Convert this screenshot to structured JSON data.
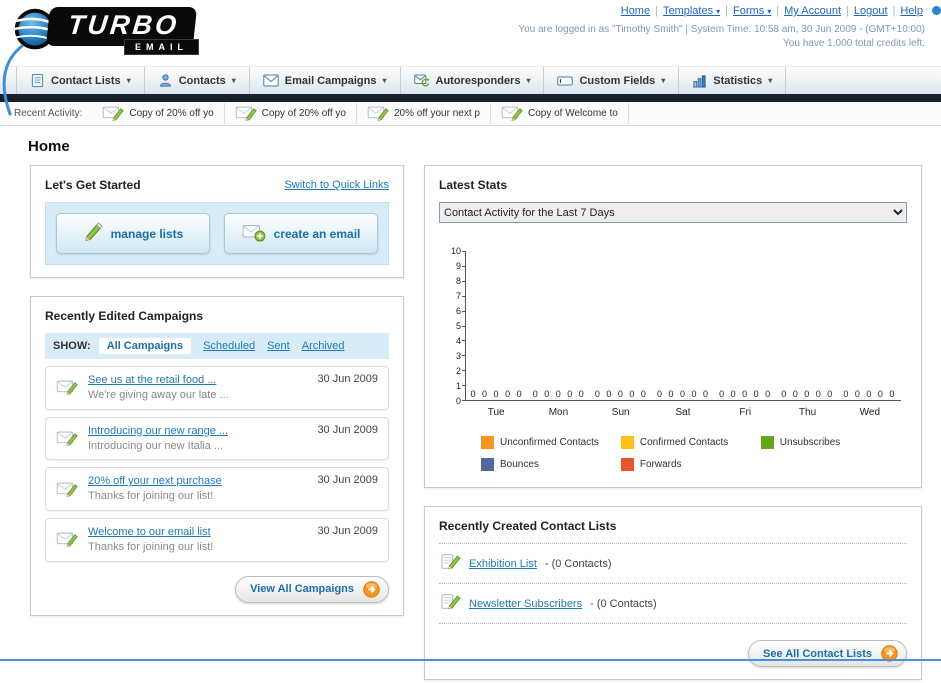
{
  "header": {
    "logo": {
      "word": "TURBO",
      "sub": "EMAIL"
    },
    "links": [
      {
        "label": "Home",
        "dropdown": false
      },
      {
        "label": "Templates",
        "dropdown": true
      },
      {
        "label": "Forms",
        "dropdown": true
      },
      {
        "label": "My Account",
        "dropdown": false
      },
      {
        "label": "Logout",
        "dropdown": false
      },
      {
        "label": "Help",
        "dropdown": false
      }
    ],
    "login_info": "You are logged in as \"Timothy Smith\" | System Time: 10:58 am, 30 Jun 2009 - (GMT+10:00)",
    "credits": "You have 1,000 total credits left."
  },
  "nav_tabs": [
    {
      "label": "Contact Lists",
      "icon": "contact-lists-icon"
    },
    {
      "label": "Contacts",
      "icon": "contacts-icon"
    },
    {
      "label": "Email Campaigns",
      "icon": "email-campaigns-icon"
    },
    {
      "label": "Autoresponders",
      "icon": "autoresponders-icon"
    },
    {
      "label": "Custom Fields",
      "icon": "custom-fields-icon"
    },
    {
      "label": "Statistics",
      "icon": "statistics-icon"
    }
  ],
  "recent_activity": {
    "label": "Recent Activity:",
    "items": [
      {
        "text": "Copy of 20% off yo",
        "icon": "envelope-pencil-icon"
      },
      {
        "text": "Copy of 20% off yo",
        "icon": "envelope-pencil-icon"
      },
      {
        "text": "20% off your next p",
        "icon": "envelope-pencil-icon"
      },
      {
        "text": "Copy of Welcome to",
        "icon": "envelope-pencil-icon"
      }
    ]
  },
  "page_title": "Home",
  "get_started": {
    "title": "Let's Get Started",
    "switch_link": "Switch to Quick Links",
    "buttons": [
      {
        "label": "manage lists",
        "icon": "pencil-icon"
      },
      {
        "label": "create an email",
        "icon": "envelope-plus-icon"
      }
    ]
  },
  "campaigns": {
    "title": "Recently Edited Campaigns",
    "show_label": "SHOW:",
    "filters": [
      {
        "label": "All Campaigns",
        "active": true
      },
      {
        "label": "Scheduled",
        "active": false
      },
      {
        "label": "Sent",
        "active": false
      },
      {
        "label": "Archived",
        "active": false
      }
    ],
    "items": [
      {
        "title": "See us at the retail food ...",
        "subtitle": "We're giving away our late ...",
        "date": "30 Jun 2009"
      },
      {
        "title": "Introducing our new range ...",
        "subtitle": "Introducing our new Italia ...",
        "date": "30 Jun 2009"
      },
      {
        "title": "20% off your next purchase",
        "subtitle": "Thanks for joining our list!",
        "date": "30 Jun 2009"
      },
      {
        "title": "Welcome to our email list",
        "subtitle": "Thanks for joining our list!",
        "date": "30 Jun 2009"
      }
    ],
    "view_all_label": "View All Campaigns"
  },
  "stats": {
    "title": "Latest Stats",
    "dropdown_value": "Contact Activity for the Last 7 Days"
  },
  "chart_data": {
    "type": "bar",
    "title": "Contact Activity for the Last 7 Days",
    "categories": [
      "Tue",
      "Mon",
      "Sun",
      "Sat",
      "Fri",
      "Thu",
      "Wed"
    ],
    "series": [
      {
        "name": "Unconfirmed Contacts",
        "color": "#f79422",
        "values": [
          0,
          0,
          0,
          0,
          0,
          0,
          0
        ]
      },
      {
        "name": "Confirmed Contacts",
        "color": "#fcc018",
        "values": [
          0,
          0,
          0,
          0,
          0,
          0,
          0
        ]
      },
      {
        "name": "Unsubscribes",
        "color": "#68a51d",
        "values": [
          0,
          0,
          0,
          0,
          0,
          0,
          0
        ]
      },
      {
        "name": "Bounces",
        "color": "#51699e",
        "values": [
          0,
          0,
          0,
          0,
          0,
          0,
          0
        ]
      },
      {
        "name": "Forwards",
        "color": "#e6552b",
        "values": [
          0,
          0,
          0,
          0,
          0,
          0,
          0
        ]
      }
    ],
    "ylim": [
      0,
      10
    ],
    "yticks": [
      0,
      1,
      2,
      3,
      4,
      5,
      6,
      7,
      8,
      9,
      10
    ],
    "legend_position": "bottom",
    "grid": false
  },
  "contact_lists": {
    "title": "Recently Created Contact Lists",
    "items": [
      {
        "name": "Exhibition List",
        "detail": "- (0 Contacts)",
        "icon": "pencil-page-icon"
      },
      {
        "name": "Newsletter Subscribers",
        "detail": "- (0 Contacts)",
        "icon": "pencil-page-icon"
      }
    ],
    "see_all_label": "See All Contact Lists"
  }
}
